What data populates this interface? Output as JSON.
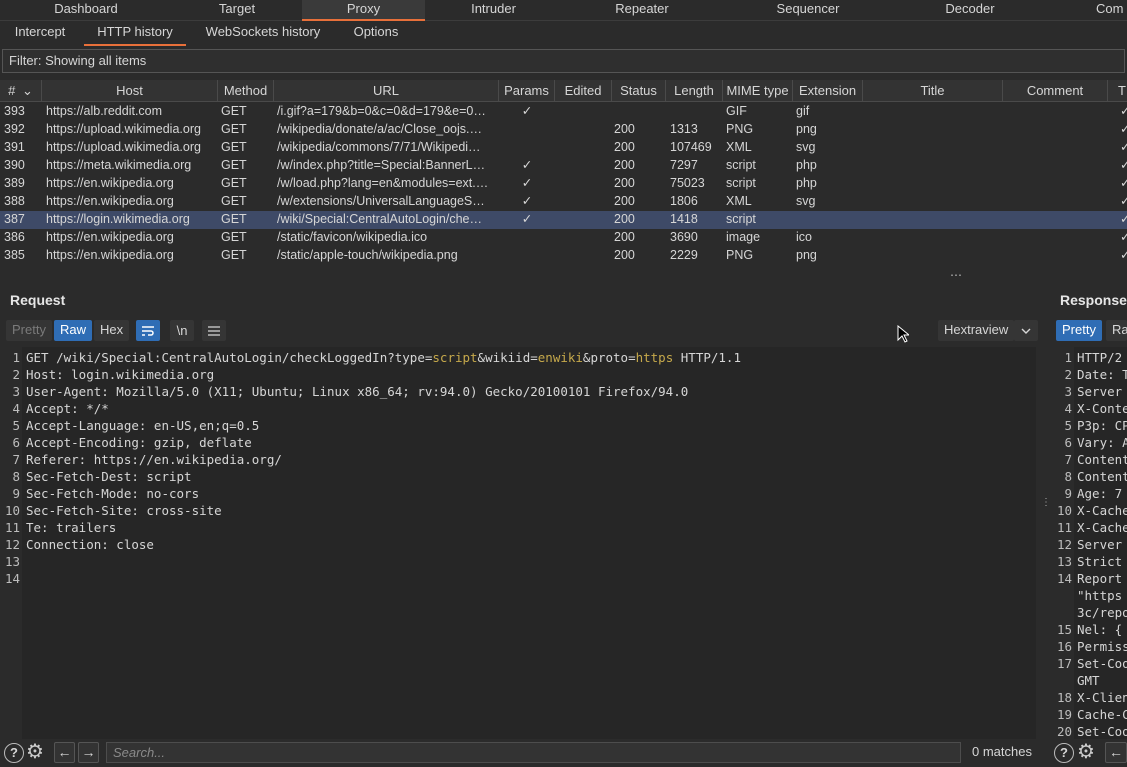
{
  "top_tabs": [
    {
      "label": "Dashboard",
      "active": false
    },
    {
      "label": "Target",
      "active": false
    },
    {
      "label": "Proxy",
      "active": true
    },
    {
      "label": "Intruder",
      "active": false
    },
    {
      "label": "Repeater",
      "active": false
    },
    {
      "label": "Sequencer",
      "active": false
    },
    {
      "label": "Decoder",
      "active": false
    },
    {
      "label": "Com",
      "active": false
    }
  ],
  "sub_tabs": [
    {
      "label": "Intercept",
      "active": false
    },
    {
      "label": "HTTP history",
      "active": true
    },
    {
      "label": "WebSockets history",
      "active": false
    },
    {
      "label": "Options",
      "active": false
    }
  ],
  "filter": {
    "text": "Filter: Showing all items"
  },
  "table": {
    "columns": [
      "#",
      "Host",
      "Method",
      "URL",
      "Params",
      "Edited",
      "Status",
      "Length",
      "MIME type",
      "Extension",
      "Title",
      "Comment",
      "TL"
    ],
    "sort_indicator": "⌄",
    "check_glyph": "✓",
    "rows": [
      {
        "id": "393",
        "host": "https://alb.reddit.com",
        "method": "GET",
        "url": "/i.gif?a=179&b=0&c=0&d=179&e=0…",
        "params": true,
        "edited": "",
        "status": "",
        "length": "",
        "mime": "GIF",
        "ext": "gif",
        "selected": false
      },
      {
        "id": "392",
        "host": "https://upload.wikimedia.org",
        "method": "GET",
        "url": "/wikipedia/donate/a/ac/Close_oojs.…",
        "params": false,
        "edited": "",
        "status": "200",
        "length": "1313",
        "mime": "PNG",
        "ext": "png",
        "selected": false
      },
      {
        "id": "391",
        "host": "https://upload.wikimedia.org",
        "method": "GET",
        "url": "/wikipedia/commons/7/71/Wikipedi…",
        "params": false,
        "edited": "",
        "status": "200",
        "length": "107469",
        "mime": "XML",
        "ext": "svg",
        "selected": false
      },
      {
        "id": "390",
        "host": "https://meta.wikimedia.org",
        "method": "GET",
        "url": "/w/index.php?title=Special:BannerL…",
        "params": true,
        "edited": "",
        "status": "200",
        "length": "7297",
        "mime": "script",
        "ext": "php",
        "selected": false
      },
      {
        "id": "389",
        "host": "https://en.wikipedia.org",
        "method": "GET",
        "url": "/w/load.php?lang=en&modules=ext.…",
        "params": true,
        "edited": "",
        "status": "200",
        "length": "75023",
        "mime": "script",
        "ext": "php",
        "selected": false
      },
      {
        "id": "388",
        "host": "https://en.wikipedia.org",
        "method": "GET",
        "url": "/w/extensions/UniversalLanguageS…",
        "params": true,
        "edited": "",
        "status": "200",
        "length": "1806",
        "mime": "XML",
        "ext": "svg",
        "selected": false
      },
      {
        "id": "387",
        "host": "https://login.wikimedia.org",
        "method": "GET",
        "url": "/wiki/Special:CentralAutoLogin/che…",
        "params": true,
        "edited": "",
        "status": "200",
        "length": "1418",
        "mime": "script",
        "ext": "",
        "selected": true
      },
      {
        "id": "386",
        "host": "https://en.wikipedia.org",
        "method": "GET",
        "url": "/static/favicon/wikipedia.ico",
        "params": false,
        "edited": "",
        "status": "200",
        "length": "3690",
        "mime": "image",
        "ext": "ico",
        "selected": false
      },
      {
        "id": "385",
        "host": "https://en.wikipedia.org",
        "method": "GET",
        "url": "/static/apple-touch/wikipedia.png",
        "params": false,
        "edited": "",
        "status": "200",
        "length": "2229",
        "mime": "PNG",
        "ext": "png",
        "selected": false
      }
    ]
  },
  "request": {
    "title": "Request",
    "buttons": {
      "pretty": "Pretty",
      "raw": "Raw",
      "hex": "Hex",
      "newline": "\\n",
      "hextraview": "Hextraview"
    },
    "lines": [
      "GET /wiki/Special:CentralAutoLogin/checkLoggedIn?type=script&wikiid=enwiki&proto=https HTTP/1.1",
      "Host: login.wikimedia.org",
      "User-Agent: Mozilla/5.0 (X11; Ubuntu; Linux x86_64; rv:94.0) Gecko/20100101 Firefox/94.0",
      "Accept: */*",
      "Accept-Language: en-US,en;q=0.5",
      "Accept-Encoding: gzip, deflate",
      "Referer: https://en.wikipedia.org/",
      "Sec-Fetch-Dest: script",
      "Sec-Fetch-Mode: no-cors",
      "Sec-Fetch-Site: cross-site",
      "Te: trailers",
      "Connection: close",
      "",
      ""
    ],
    "first_line_parts": [
      {
        "t": "GET /wiki/Special:CentralAutoLogin/checkLoggedIn?type=",
        "hl": false
      },
      {
        "t": "script",
        "hl": true
      },
      {
        "t": "&wikiid=",
        "hl": false
      },
      {
        "t": "enwiki",
        "hl": true
      },
      {
        "t": "&proto=",
        "hl": false
      },
      {
        "t": "https",
        "hl": true
      },
      {
        "t": " HTTP/1.1",
        "hl": false
      }
    ],
    "search_placeholder": "Search...",
    "matches": "0 matches"
  },
  "response": {
    "title": "Response",
    "buttons": {
      "pretty": "Pretty",
      "raw": "Ra"
    },
    "lines": [
      {
        "n": "1",
        "t": "HTTP/2"
      },
      {
        "n": "2",
        "t": "Date: T"
      },
      {
        "n": "3",
        "t": "Server"
      },
      {
        "n": "4",
        "t": "X-Conte"
      },
      {
        "n": "5",
        "t": "P3p: CP"
      },
      {
        "n": "6",
        "t": "Vary: A"
      },
      {
        "n": "7",
        "t": "Content"
      },
      {
        "n": "8",
        "t": "Content"
      },
      {
        "n": "9",
        "t": "Age: 7"
      },
      {
        "n": "10",
        "t": "X-Cache"
      },
      {
        "n": "11",
        "t": "X-Cache"
      },
      {
        "n": "12",
        "t": "Server"
      },
      {
        "n": "13",
        "t": "Strict"
      },
      {
        "n": "14",
        "t": "Report"
      },
      {
        "n": "",
        "t": "\"https"
      },
      {
        "n": "",
        "t": "3c/repo"
      },
      {
        "n": "15",
        "t": "Nel: {"
      },
      {
        "n": "16",
        "t": "Permiss"
      },
      {
        "n": "17",
        "t": "Set-Coo"
      },
      {
        "n": "",
        "t": "GMT"
      },
      {
        "n": "18",
        "t": "X-Clien"
      },
      {
        "n": "19",
        "t": "Cache-C"
      },
      {
        "n": "20",
        "t": "Set-Coo"
      }
    ]
  },
  "icons": {
    "help": "?",
    "settings": "⚙",
    "back": "←",
    "forward": "→",
    "wrap": "≡",
    "menu": "☰",
    "dropdown": "⌄",
    "more": "⋯",
    "grip": "⋮"
  }
}
